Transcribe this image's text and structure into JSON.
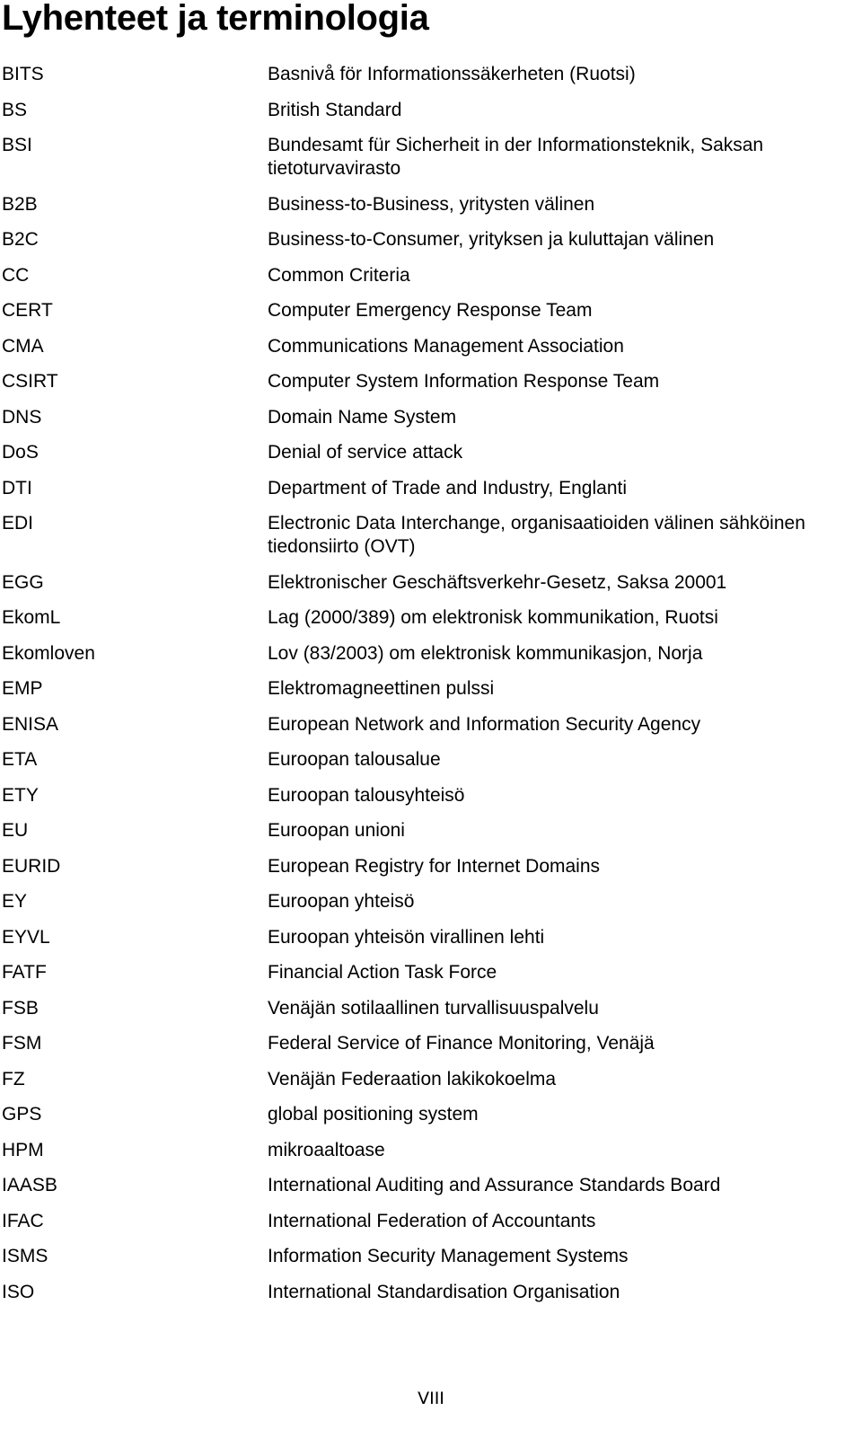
{
  "page": {
    "title": "Lyhenteet ja terminologia",
    "page_number": "VIII"
  },
  "glossary": [
    {
      "abbr": "BITS",
      "definition": "Basnivå för Informationssäkerheten (Ruotsi)"
    },
    {
      "abbr": "BS",
      "definition": "British Standard"
    },
    {
      "abbr": "BSI",
      "definition": "Bundesamt für Sicherheit in der Informationsteknik, Saksan\ntietoturvavirasto"
    },
    {
      "abbr": "B2B",
      "definition": "Business-to-Business, yritysten välinen"
    },
    {
      "abbr": "B2C",
      "definition": "Business-to-Consumer, yrityksen ja kuluttajan välinen"
    },
    {
      "abbr": "CC",
      "definition": "Common Criteria"
    },
    {
      "abbr": "CERT",
      "definition": "Computer Emergency Response Team"
    },
    {
      "abbr": "CMA",
      "definition": "Communications Management Association"
    },
    {
      "abbr": "CSIRT",
      "definition": "Computer System Information Response Team"
    },
    {
      "abbr": "DNS",
      "definition": "Domain Name System"
    },
    {
      "abbr": "DoS",
      "definition": "Denial of service attack"
    },
    {
      "abbr": "DTI",
      "definition": "Department of Trade and Industry, Englanti"
    },
    {
      "abbr": "EDI",
      "definition": "Electronic Data Interchange, organisaatioiden välinen sähköinen\ntiedonsiirto (OVT)"
    },
    {
      "abbr": "EGG",
      "definition": "Elektronischer Geschäftsverkehr-Gesetz, Saksa 20001"
    },
    {
      "abbr": "EkomL",
      "definition": "Lag (2000/389) om elektronisk kommunikation, Ruotsi"
    },
    {
      "abbr": "Ekomloven",
      "definition": "Lov (83/2003) om elektronisk kommunikasjon, Norja"
    },
    {
      "abbr": "EMP",
      "definition": "Elektromagneettinen pulssi"
    },
    {
      "abbr": "ENISA",
      "definition": "European Network and Information Security Agency"
    },
    {
      "abbr": "ETA",
      "definition": "Euroopan talousalue"
    },
    {
      "abbr": "ETY",
      "definition": "Euroopan talousyhteisö"
    },
    {
      "abbr": "EU",
      "definition": "Euroopan unioni"
    },
    {
      "abbr": "EURID",
      "definition": "European Registry for Internet Domains"
    },
    {
      "abbr": "EY",
      "definition": "Euroopan yhteisö"
    },
    {
      "abbr": "EYVL",
      "definition": "Euroopan yhteisön virallinen lehti"
    },
    {
      "abbr": "FATF",
      "definition": "Financial Action Task Force"
    },
    {
      "abbr": "FSB",
      "definition": "Venäjän sotilaallinen turvallisuuspalvelu"
    },
    {
      "abbr": "FSM",
      "definition": "Federal Service of Finance Monitoring, Venäjä"
    },
    {
      "abbr": "FZ",
      "definition": "Venäjän Federaation lakikokoelma"
    },
    {
      "abbr": "GPS",
      "definition": "global positioning system"
    },
    {
      "abbr": "HPM",
      "definition": "mikroaaltoase"
    },
    {
      "abbr": "IAASB",
      "definition": "International Auditing and Assurance Standards Board"
    },
    {
      "abbr": "IFAC",
      "definition": "International Federation of Accountants"
    },
    {
      "abbr": "ISMS",
      "definition": "Information Security Management Systems"
    },
    {
      "abbr": "ISO",
      "definition": "International Standardisation Organisation"
    }
  ]
}
